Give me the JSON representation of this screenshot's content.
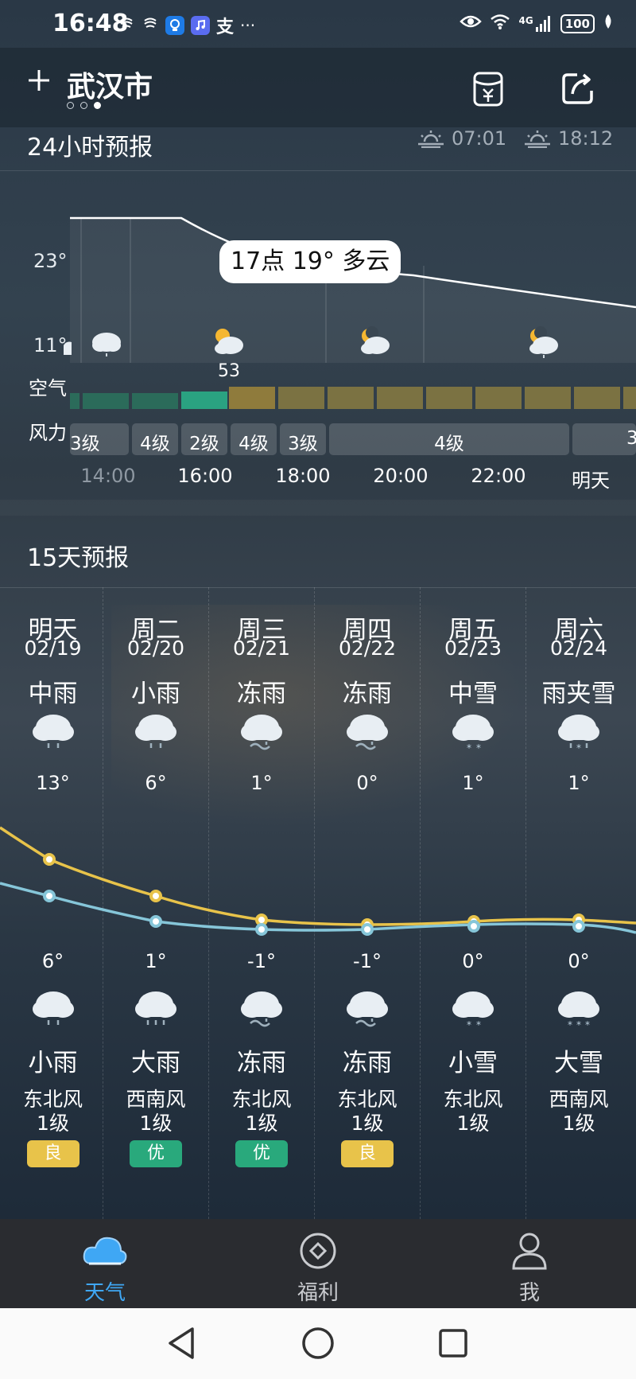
{
  "status_bar": {
    "time": "16:48",
    "left_app_icons": [
      "notification-icon",
      "notification-icon",
      "bulb-app-icon",
      "music-app-icon",
      "alipay-app-icon"
    ],
    "overflow": "···",
    "network": "4G",
    "battery": "100"
  },
  "header": {
    "city": "武汉市",
    "page_dots": 3,
    "active_dot": 2
  },
  "hourly": {
    "title": "24小时预报",
    "sunrise": "07:01",
    "sunset": "18:12",
    "ymax_label": "23°",
    "ymin_label": "11°",
    "bubble": "17点 19° 多云",
    "air_label": "空气",
    "air_value": "53",
    "wind_label": "风力",
    "wind_segments": [
      "3级",
      "4级",
      "2级",
      "4级",
      "3级",
      "4级",
      "3"
    ],
    "ticks": [
      "14:00",
      "16:00",
      "18:00",
      "20:00",
      "22:00",
      "明天"
    ]
  },
  "daily": {
    "title": "15天预报",
    "days": [
      {
        "weekday": "明天",
        "date": "02/19",
        "day_weather": "中雨",
        "high": "13°",
        "low": "6°",
        "night_weather": "小雨",
        "wind_dir": "东北风",
        "wind_level": "1级",
        "aqi": "良",
        "aqi_class": "good",
        "day_icon": "rain-icon",
        "night_icon": "rain-icon"
      },
      {
        "weekday": "周二",
        "date": "02/20",
        "day_weather": "小雨",
        "high": "6°",
        "low": "1°",
        "night_weather": "大雨",
        "wind_dir": "西南风",
        "wind_level": "1级",
        "aqi": "优",
        "aqi_class": "excellent",
        "day_icon": "rain-icon",
        "night_icon": "heavy-rain-icon"
      },
      {
        "weekday": "周三",
        "date": "02/21",
        "day_weather": "冻雨",
        "high": "1°",
        "low": "-1°",
        "night_weather": "冻雨",
        "wind_dir": "东北风",
        "wind_level": "1级",
        "aqi": "优",
        "aqi_class": "excellent",
        "day_icon": "freezing-rain-icon",
        "night_icon": "freezing-rain-icon"
      },
      {
        "weekday": "周四",
        "date": "02/22",
        "day_weather": "冻雨",
        "high": "0°",
        "low": "-1°",
        "night_weather": "冻雨",
        "wind_dir": "东北风",
        "wind_level": "1级",
        "aqi": "良",
        "aqi_class": "good",
        "day_icon": "freezing-rain-icon",
        "night_icon": "freezing-rain-icon"
      },
      {
        "weekday": "周五",
        "date": "02/23",
        "day_weather": "中雪",
        "high": "1°",
        "low": "0°",
        "night_weather": "小雪",
        "wind_dir": "东北风",
        "wind_level": "1级",
        "aqi": "",
        "aqi_class": "",
        "day_icon": "snow-icon",
        "night_icon": "snow-icon"
      },
      {
        "weekday": "周六",
        "date": "02/24",
        "day_weather": "雨夹雪",
        "high": "1°",
        "low": "0°",
        "night_weather": "大雪",
        "wind_dir": "西南风",
        "wind_level": "1级",
        "aqi": "",
        "aqi_class": "",
        "day_icon": "sleet-icon",
        "night_icon": "heavy-snow-icon"
      }
    ]
  },
  "bottom_nav": [
    {
      "label": "天气",
      "icon": "cloud-icon",
      "active": true
    },
    {
      "label": "福利",
      "icon": "diamond-icon",
      "active": false
    },
    {
      "label": "我",
      "icon": "person-icon",
      "active": false
    }
  ],
  "colors": {
    "accent": "#3fa7f4",
    "high_line": "#e8c34a",
    "low_line": "#86c6d9",
    "aqi_good": "#e8c34a",
    "aqi_excellent": "#29a97c",
    "air_bar_green": "#2b6b5a",
    "air_bar_yellow": "#8f7b3c"
  }
}
